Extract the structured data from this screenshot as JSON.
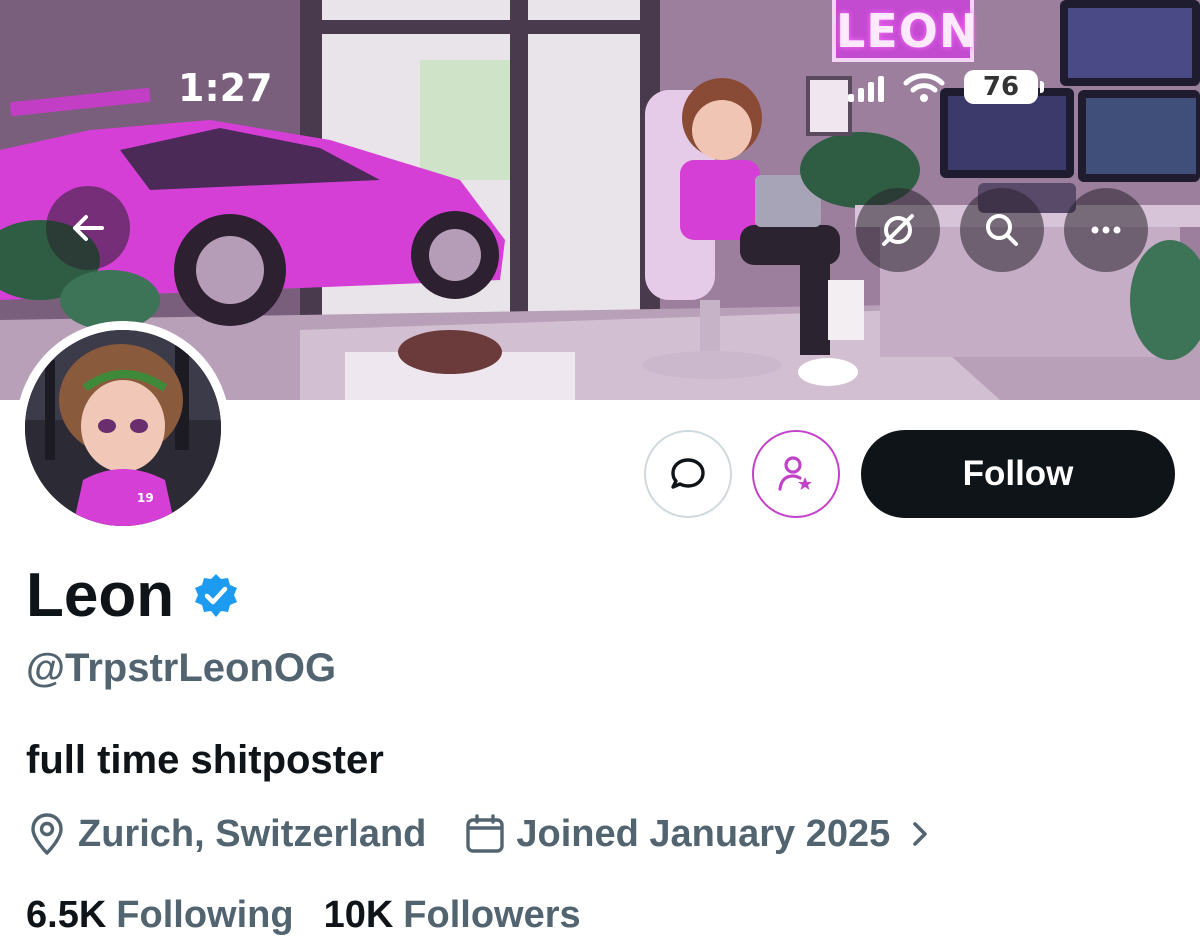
{
  "status_bar": {
    "time": "1:27",
    "battery": "76"
  },
  "banner": {
    "sign_text": "LEON",
    "jersey_number": "19"
  },
  "header_actions": {
    "back_icon": "arrow-left-icon",
    "grok_icon": "grok-icon",
    "search_icon": "search-icon",
    "more_icon": "more-horizontal-icon"
  },
  "profile_actions": {
    "message_icon": "message-icon",
    "subscribe_icon": "subscribe-icon",
    "follow_label": "Follow"
  },
  "profile": {
    "display_name": "Leon",
    "verified": true,
    "handle": "@TrpstrLeonOG",
    "bio": "full time shitposter",
    "location": "Zurich, Switzerland",
    "joined": "Joined January 2025",
    "following_count": "6.5K",
    "following_label": "Following",
    "followers_count": "10K",
    "followers_label": "Followers"
  },
  "colors": {
    "accent_blue": "#1d9bf0",
    "text_primary": "#0f1419",
    "text_secondary": "#536471",
    "subscribe_purple": "#c243c9",
    "banner_pink": "#d53fd6"
  }
}
